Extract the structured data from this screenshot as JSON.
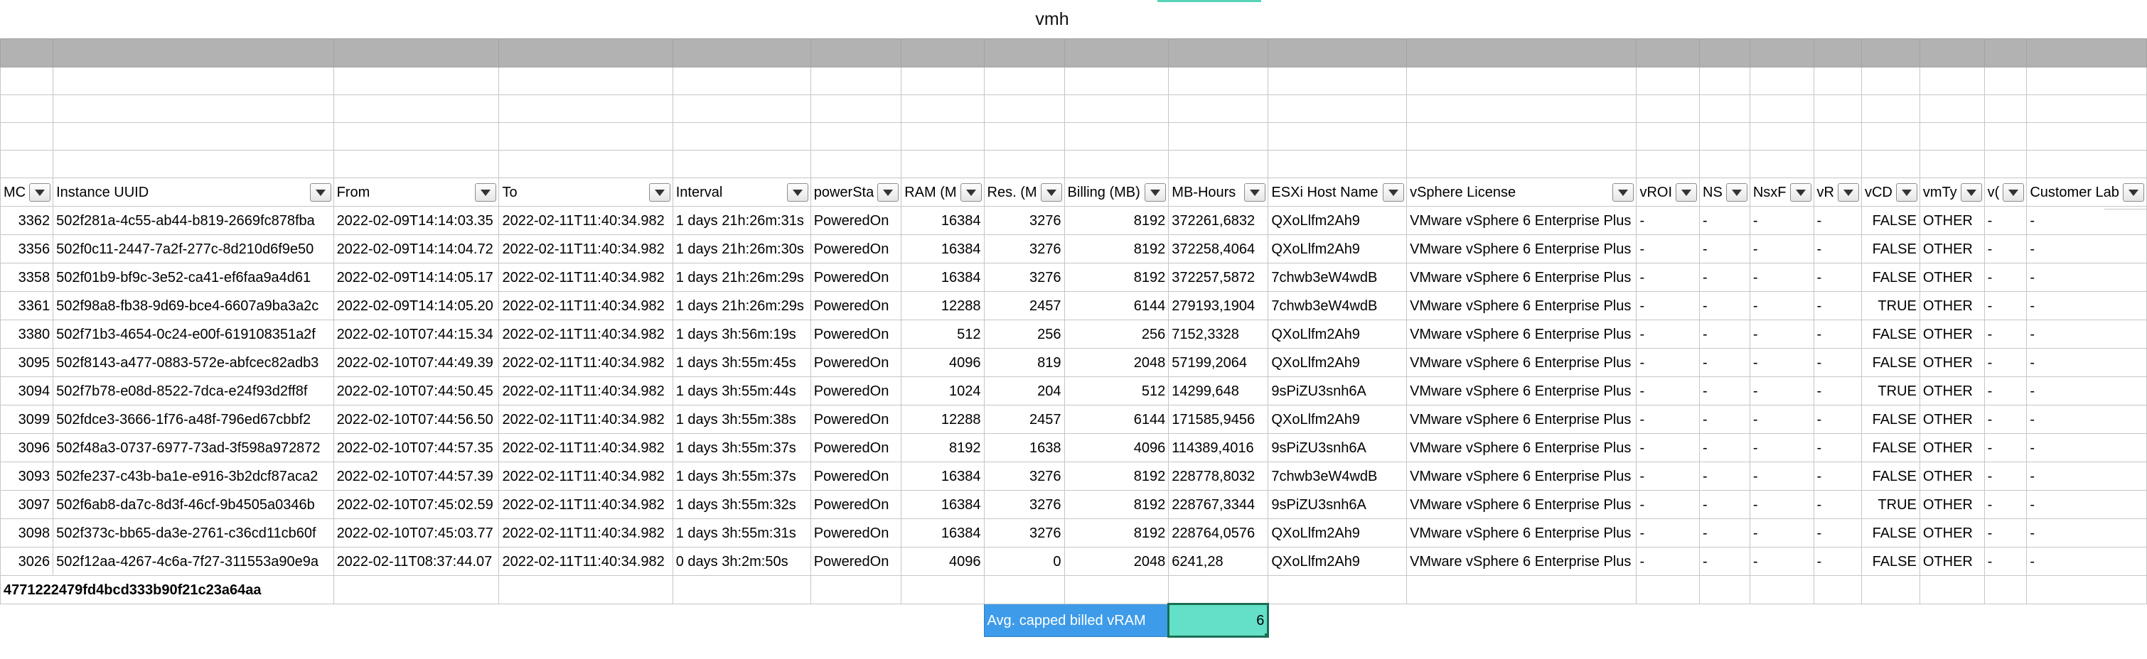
{
  "sheet": {
    "title": "vmh",
    "columns": [
      {
        "header": "MC",
        "align": "right"
      },
      {
        "header": "Instance UUID",
        "align": "left"
      },
      {
        "header": "From",
        "align": "left"
      },
      {
        "header": "To",
        "align": "left"
      },
      {
        "header": "Interval",
        "align": "left"
      },
      {
        "header": "powerSta",
        "align": "left"
      },
      {
        "header": "RAM (M",
        "align": "right"
      },
      {
        "header": "Res. (M",
        "align": "right"
      },
      {
        "header": "Billing (MB)",
        "align": "right"
      },
      {
        "header": "MB-Hours",
        "align": "left"
      },
      {
        "header": "ESXi Host Name",
        "align": "left"
      },
      {
        "header": "vSphere License",
        "align": "left"
      },
      {
        "header": "vROI",
        "align": "left"
      },
      {
        "header": "NS",
        "align": "left"
      },
      {
        "header": "NsxF",
        "align": "left"
      },
      {
        "header": "vR",
        "align": "left"
      },
      {
        "header": "vCD",
        "align": "right"
      },
      {
        "header": "vmTy",
        "align": "left"
      },
      {
        "header": "v(",
        "align": "left"
      },
      {
        "header": "Customer Lab",
        "align": "left"
      }
    ],
    "rows": [
      [
        "3362",
        "502f281a-4c55-ab44-b819-2669fc878fba",
        "2022-02-09T14:14:03.35",
        "2022-02-11T11:40:34.982",
        "1 days 21h:26m:31s",
        "PoweredOn",
        "16384",
        "3276",
        "8192",
        "372261,6832",
        "QXoLlfm2Ah9",
        "VMware vSphere 6 Enterprise Plus",
        "-",
        "-",
        "-",
        "-",
        "FALSE",
        "OTHER",
        "-",
        "-"
      ],
      [
        "3356",
        "502f0c11-2447-7a2f-277c-8d210d6f9e50",
        "2022-02-09T14:14:04.72",
        "2022-02-11T11:40:34.982",
        "1 days 21h:26m:30s",
        "PoweredOn",
        "16384",
        "3276",
        "8192",
        "372258,4064",
        "QXoLlfm2Ah9",
        "VMware vSphere 6 Enterprise Plus",
        "-",
        "-",
        "-",
        "-",
        "FALSE",
        "OTHER",
        "-",
        "-"
      ],
      [
        "3358",
        "502f01b9-bf9c-3e52-ca41-ef6faa9a4d61",
        "2022-02-09T14:14:05.17",
        "2022-02-11T11:40:34.982",
        "1 days 21h:26m:29s",
        "PoweredOn",
        "16384",
        "3276",
        "8192",
        "372257,5872",
        "7chwb3eW4wdB",
        "VMware vSphere 6 Enterprise Plus",
        "-",
        "-",
        "-",
        "-",
        "FALSE",
        "OTHER",
        "-",
        "-"
      ],
      [
        "3361",
        "502f98a8-fb38-9d69-bce4-6607a9ba3a2c",
        "2022-02-09T14:14:05.20",
        "2022-02-11T11:40:34.982",
        "1 days 21h:26m:29s",
        "PoweredOn",
        "12288",
        "2457",
        "6144",
        "279193,1904",
        "7chwb3eW4wdB",
        "VMware vSphere 6 Enterprise Plus",
        "-",
        "-",
        "-",
        "-",
        "TRUE",
        "OTHER",
        "-",
        "-"
      ],
      [
        "3380",
        "502f71b3-4654-0c24-e00f-619108351a2f",
        "2022-02-10T07:44:15.34",
        "2022-02-11T11:40:34.982",
        "1 days 3h:56m:19s",
        "PoweredOn",
        "512",
        "256",
        "256",
        "7152,3328",
        "QXoLlfm2Ah9",
        "VMware vSphere 6 Enterprise Plus",
        "-",
        "-",
        "-",
        "-",
        "FALSE",
        "OTHER",
        "-",
        "-"
      ],
      [
        "3095",
        "502f8143-a477-0883-572e-abfcec82adb3",
        "2022-02-10T07:44:49.39",
        "2022-02-11T11:40:34.982",
        "1 days 3h:55m:45s",
        "PoweredOn",
        "4096",
        "819",
        "2048",
        "57199,2064",
        "QXoLlfm2Ah9",
        "VMware vSphere 6 Enterprise Plus",
        "-",
        "-",
        "-",
        "-",
        "FALSE",
        "OTHER",
        "-",
        "-"
      ],
      [
        "3094",
        "502f7b78-e08d-8522-7dca-e24f93d2ff8f",
        "2022-02-10T07:44:50.45",
        "2022-02-11T11:40:34.982",
        "1 days 3h:55m:44s",
        "PoweredOn",
        "1024",
        "204",
        "512",
        "14299,648",
        "9sPiZU3snh6A",
        "VMware vSphere 6 Enterprise Plus",
        "-",
        "-",
        "-",
        "-",
        "TRUE",
        "OTHER",
        "-",
        "-"
      ],
      [
        "3099",
        "502fdce3-3666-1f76-a48f-796ed67cbbf2",
        "2022-02-10T07:44:56.50",
        "2022-02-11T11:40:34.982",
        "1 days 3h:55m:38s",
        "PoweredOn",
        "12288",
        "2457",
        "6144",
        "171585,9456",
        "QXoLlfm2Ah9",
        "VMware vSphere 6 Enterprise Plus",
        "-",
        "-",
        "-",
        "-",
        "FALSE",
        "OTHER",
        "-",
        "-"
      ],
      [
        "3096",
        "502f48a3-0737-6977-73ad-3f598a972872",
        "2022-02-10T07:44:57.35",
        "2022-02-11T11:40:34.982",
        "1 days 3h:55m:37s",
        "PoweredOn",
        "8192",
        "1638",
        "4096",
        "114389,4016",
        "9sPiZU3snh6A",
        "VMware vSphere 6 Enterprise Plus",
        "-",
        "-",
        "-",
        "-",
        "FALSE",
        "OTHER",
        "-",
        "-"
      ],
      [
        "3093",
        "502fe237-c43b-ba1e-e916-3b2dcf87aca2",
        "2022-02-10T07:44:57.39",
        "2022-02-11T11:40:34.982",
        "1 days 3h:55m:37s",
        "PoweredOn",
        "16384",
        "3276",
        "8192",
        "228778,8032",
        "7chwb3eW4wdB",
        "VMware vSphere 6 Enterprise Plus",
        "-",
        "-",
        "-",
        "-",
        "FALSE",
        "OTHER",
        "-",
        "-"
      ],
      [
        "3097",
        "502f6ab8-da7c-8d3f-46cf-9b4505a0346b",
        "2022-02-10T07:45:02.59",
        "2022-02-11T11:40:34.982",
        "1 days 3h:55m:32s",
        "PoweredOn",
        "16384",
        "3276",
        "8192",
        "228767,3344",
        "9sPiZU3snh6A",
        "VMware vSphere 6 Enterprise Plus",
        "-",
        "-",
        "-",
        "-",
        "TRUE",
        "OTHER",
        "-",
        "-"
      ],
      [
        "3098",
        "502f373c-bb65-da3e-2761-c36cd11cb60f",
        "2022-02-10T07:45:03.77",
        "2022-02-11T11:40:34.982",
        "1 days 3h:55m:31s",
        "PoweredOn",
        "16384",
        "3276",
        "8192",
        "228764,0576",
        "QXoLlfm2Ah9",
        "VMware vSphere 6 Enterprise Plus",
        "-",
        "-",
        "-",
        "-",
        "FALSE",
        "OTHER",
        "-",
        "-"
      ],
      [
        "3026",
        "502f12aa-4267-4c6a-7f27-311553a90e9a",
        "2022-02-11T08:37:44.07",
        "2022-02-11T11:40:34.982",
        "0 days 3h:2m:50s",
        "PoweredOn",
        "4096",
        "0",
        "2048",
        "6241,28",
        "QXoLlfm2Ah9",
        "VMware vSphere 6 Enterprise Plus",
        "-",
        "-",
        "-",
        "-",
        "FALSE",
        "OTHER",
        "-",
        "-"
      ]
    ],
    "hash_row_text": "4771222479fd4bcd333b90f21c23a64aa",
    "summary": {
      "label": "Avg. capped billed vRAM",
      "value": "6"
    },
    "colors": {
      "header_gray": "#b2b2b2",
      "label_blue": "#3d9be9",
      "value_teal": "#64e0c8"
    }
  }
}
